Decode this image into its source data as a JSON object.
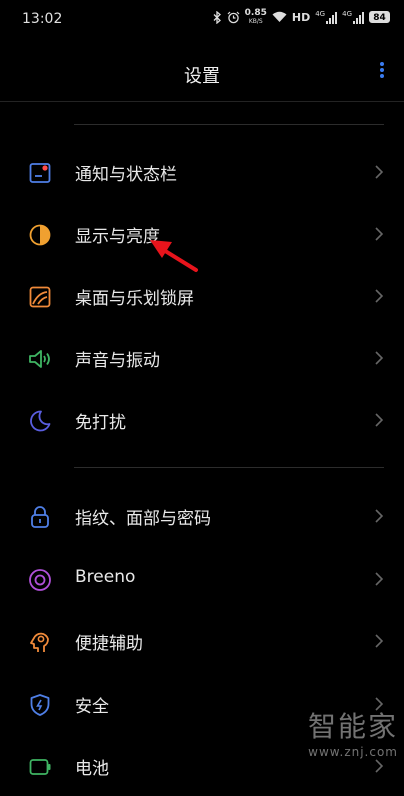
{
  "status_bar": {
    "time": "13:02",
    "network_speed_value": "0.85",
    "network_speed_unit": "KB/S",
    "hd_label": "HD",
    "sim1_label": "4G",
    "sim2_label": "4G",
    "battery_level": "84"
  },
  "header": {
    "title": "设置"
  },
  "menu": [
    {
      "label": "通知与状态栏",
      "icon": "notification-icon"
    },
    {
      "label": "显示与亮度",
      "icon": "brightness-icon"
    },
    {
      "label": "桌面与乐划锁屏",
      "icon": "wallpaper-icon"
    },
    {
      "label": "声音与振动",
      "icon": "speaker-icon"
    },
    {
      "label": "免打扰",
      "icon": "moon-icon"
    },
    {
      "label": "指纹、面部与密码",
      "icon": "lock-icon"
    },
    {
      "label": "Breeno",
      "icon": "breeno-icon"
    },
    {
      "label": "便捷辅助",
      "icon": "assist-icon"
    },
    {
      "label": "安全",
      "icon": "shield-icon"
    },
    {
      "label": "电池",
      "icon": "battery-icon"
    }
  ],
  "watermark": {
    "brand": "智能家",
    "url": "www.znj.com"
  },
  "colors": {
    "background": "#000000",
    "accent_blue": "#3a7cf0",
    "annotation_red": "#e8141c"
  }
}
